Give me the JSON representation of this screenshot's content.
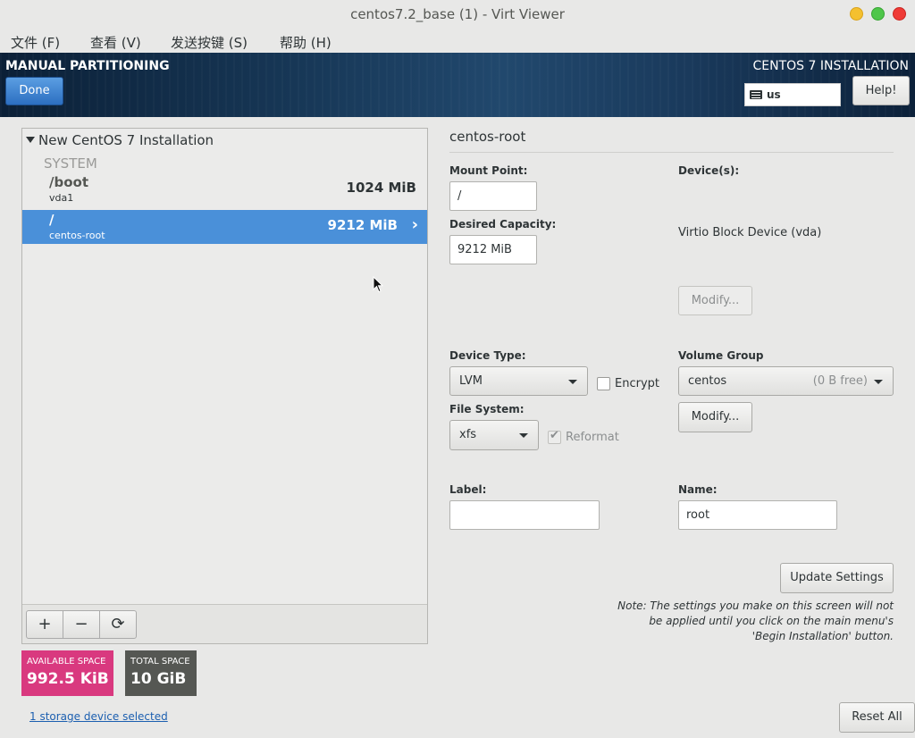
{
  "window": {
    "title": "centos7.2_base (1) - Virt Viewer"
  },
  "menu": [
    "文件 (F)",
    "查看 (V)",
    "发送按键 (S)",
    "帮助 (H)"
  ],
  "header": {
    "title": "MANUAL PARTITIONING",
    "done_label": "Done",
    "product": "CENTOS 7 INSTALLATION",
    "keyboard_layout": "us",
    "help_label": "Help!"
  },
  "tree": {
    "root_label": "New CentOS 7 Installation",
    "section": "SYSTEM",
    "items": [
      {
        "mount": "/boot",
        "device": "vda1",
        "size": "1024 MiB"
      },
      {
        "mount": "/",
        "device": "centos-root",
        "size": "9212 MiB"
      }
    ]
  },
  "toolbar": {
    "add": "+",
    "remove": "−",
    "refresh": "⟳"
  },
  "space": {
    "available_label": "AVAILABLE SPACE",
    "available_value": "992.5 KiB",
    "total_label": "TOTAL SPACE",
    "total_value": "10 GiB"
  },
  "storage_link": "1 storage device selected",
  "reset_label": "Reset All",
  "detail": {
    "title": "centos-root",
    "mount_point_label": "Mount Point:",
    "mount_point": "/",
    "capacity_label": "Desired Capacity:",
    "capacity": "9212 MiB",
    "devices_label": "Device(s):",
    "device_name": "Virtio Block Device (vda)",
    "modify_disabled_label": "Modify...",
    "device_type_label": "Device Type:",
    "device_type": "LVM",
    "encrypt_label": "Encrypt",
    "volume_group_label": "Volume Group",
    "volume_group": "centos",
    "volume_group_free": "(0 B free)",
    "modify_label": "Modify...",
    "filesystem_label": "File System:",
    "filesystem": "xfs",
    "reformat_label": "Reformat",
    "label_label": "Label:",
    "label_value": "",
    "name_label": "Name:",
    "name_value": "root",
    "update_label": "Update Settings",
    "note": "Note:  The settings you make on this screen will not be applied until you click on the main menu's 'Begin Installation' button."
  }
}
